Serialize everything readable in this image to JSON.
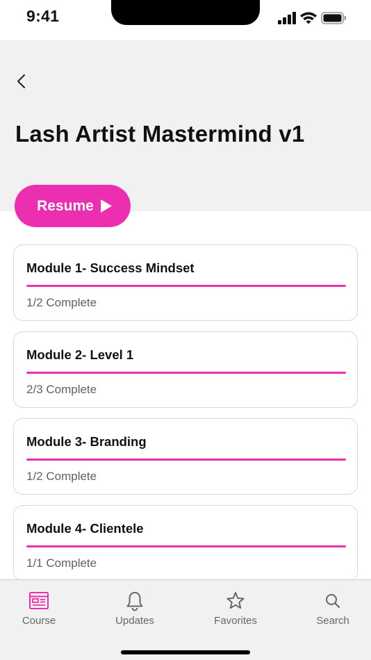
{
  "status_bar": {
    "time": "9:41",
    "icons": [
      "cellular-signal-icon",
      "wifi-icon",
      "battery-icon"
    ]
  },
  "header": {
    "back_icon": "chevron-left-icon",
    "title": "Lash Artist Mastermind v1"
  },
  "resume_button": {
    "label": "Resume",
    "icon": "play-icon"
  },
  "modules": [
    {
      "title": "Module 1- Success Mindset",
      "status": "1/2 Complete",
      "progress": 1.0
    },
    {
      "title": "Module 2- Level 1",
      "status": "2/3 Complete",
      "progress": 1.0
    },
    {
      "title": "Module 3- Branding",
      "status": "1/2 Complete",
      "progress": 1.0
    },
    {
      "title": "Module 4- Clientele",
      "status": "1/1 Complete",
      "progress": 1.0
    }
  ],
  "tab_bar": {
    "tabs": [
      {
        "label": "Course",
        "icon": "course-icon",
        "active": true
      },
      {
        "label": "Updates",
        "icon": "bell-icon",
        "active": false
      },
      {
        "label": "Favorites",
        "icon": "star-icon",
        "active": false
      },
      {
        "label": "Search",
        "icon": "search-icon",
        "active": false
      }
    ]
  },
  "colors": {
    "accent": "#ec2eb1",
    "header_background": "#f1f1f1",
    "tab_inactive": "#666666"
  }
}
